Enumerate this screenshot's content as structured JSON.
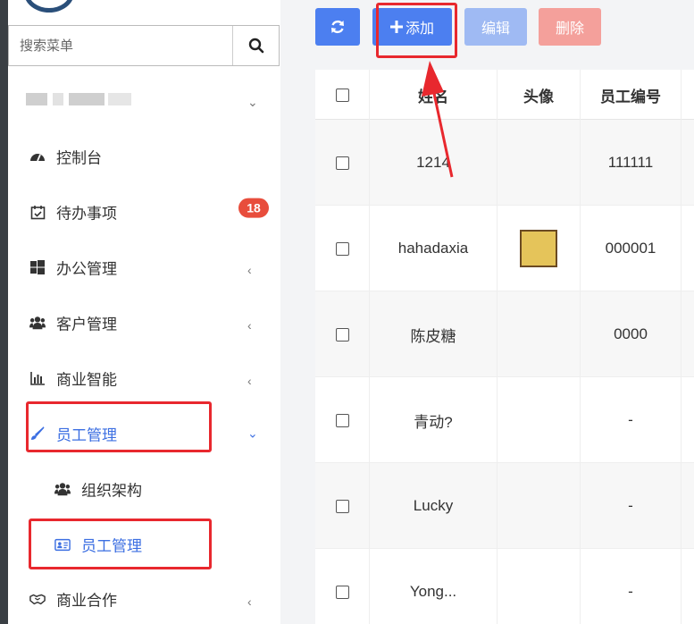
{
  "sidebar": {
    "search_placeholder": "搜索菜单",
    "menu": {
      "dashboard": "控制台",
      "todo": "待办事项",
      "todo_badge": "18",
      "office": "办公管理",
      "customer": "客户管理",
      "bi": "商业智能",
      "staff": "员工管理",
      "org": "组织架构",
      "staff_sub": "员工管理",
      "partner": "商业合作"
    },
    "arrows": {
      "down": "⌄",
      "left": "‹"
    }
  },
  "toolbar": {
    "add_label": "添加",
    "edit_label": "编辑",
    "delete_label": "删除"
  },
  "table": {
    "headers": {
      "name": "姓名",
      "avatar": "头像",
      "number": "员工编号"
    },
    "rows": [
      {
        "name": "1214",
        "number": "111111"
      },
      {
        "name": "hahadaxia",
        "number": "000001"
      },
      {
        "name": "陈皮糖",
        "number": "0000"
      },
      {
        "name": "青动?",
        "number": "-"
      },
      {
        "name": "Lucky",
        "number": "-"
      },
      {
        "name": "Yong...",
        "number": "-"
      }
    ]
  },
  "colors": {
    "primary": "#4c7ff0",
    "primary_disabled": "#9fbaf3",
    "danger_disabled": "#f4a09b",
    "badge": "#e84d3c",
    "highlight": "#e8282e",
    "active_text": "#3c6fe2"
  }
}
